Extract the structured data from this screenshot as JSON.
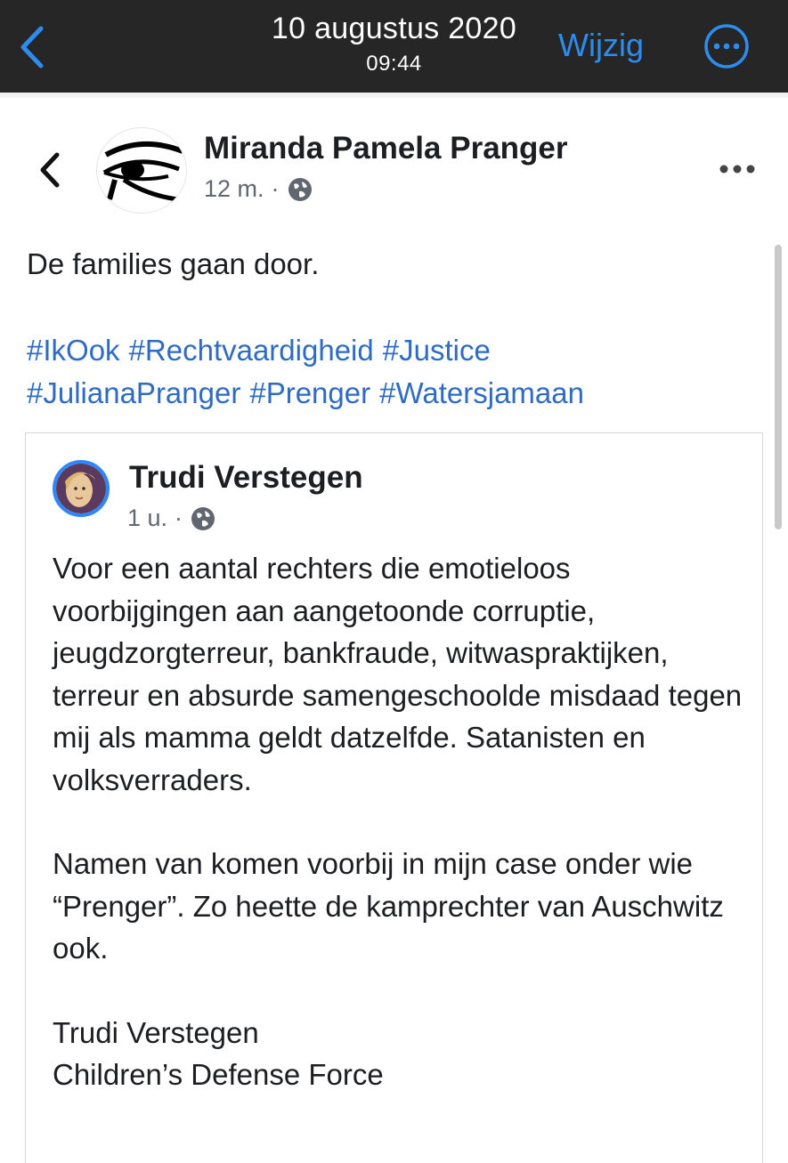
{
  "topbar": {
    "date": "10 augustus 2020",
    "time": "09:44",
    "edit_label": "Wijzig",
    "accent_color": "#2d8cf0",
    "back_icon": "chevron-left-icon",
    "more_icon": "ellipsis-circle-icon"
  },
  "post": {
    "author": "Miranda Pamela Pranger",
    "time": "12 m.",
    "separator": "·",
    "privacy_icon": "globe-icon",
    "text": "De families gaan door.",
    "hashtags": [
      "#IkOok",
      "#Rechtvaardigheid",
      "#Justice",
      "#JulianaPranger",
      "#Prenger",
      "#Watersjamaan"
    ],
    "hashtag_color": "#2e6bc4"
  },
  "shared": {
    "author": "Trudi Verstegen",
    "time": "1 u.",
    "separator": "·",
    "privacy_icon": "globe-icon",
    "paragraphs": [
      "Voor een aantal rechters die emotieloos voorbijgingen aan aangetoonde corruptie, jeugdzorgterreur, bankfraude, witwaspraktijken, terreur en absurde samengeschoolde misdaad tegen mij als mamma geldt datzelfde. Satanisten en volksverraders.",
      "Namen van komen voorbij in mijn case onder wie “Prenger”. Zo heette de kamprechter van Auschwitz ook."
    ],
    "signature_name": "Trudi Verstegen",
    "signature_org": "Children’s Defense Force"
  }
}
